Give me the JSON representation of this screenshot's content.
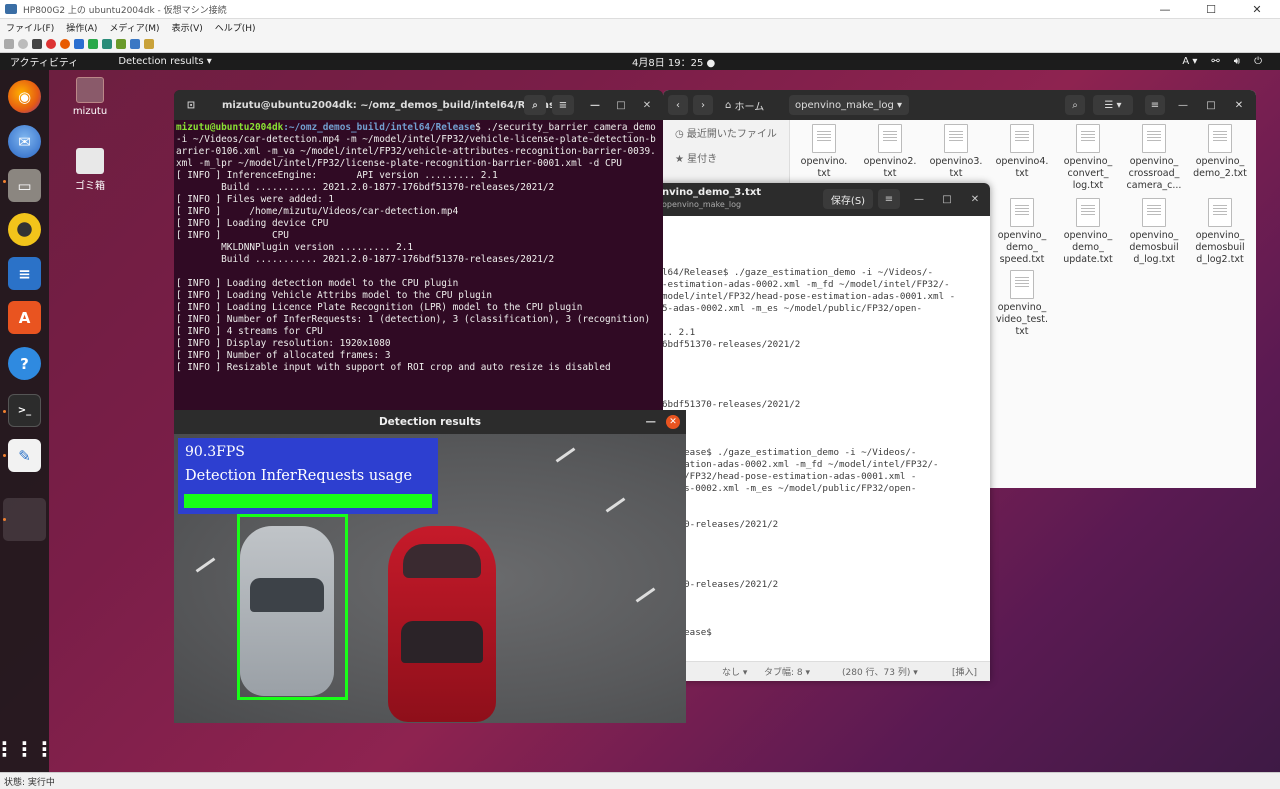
{
  "host": {
    "title": "HP800G2 上の ubuntu2004dk - 仮想マシン接続",
    "menu": [
      "ファイル(F)",
      "操作(A)",
      "メディア(M)",
      "表示(V)",
      "ヘルプ(H)"
    ],
    "status": "状態: 実行中"
  },
  "topbar": {
    "activities": "アクティビティ",
    "app_menu": "Detection results ▾",
    "clock": "4月8日 19：25 ●",
    "lang": "A ▾"
  },
  "desktop_icons": [
    {
      "label": "mizutu",
      "icon": "home-folder-icon"
    },
    {
      "label": "ゴミ箱",
      "icon": "trash-icon"
    }
  ],
  "dock": [
    "firefox-icon",
    "thunderbird-icon",
    "files-icon",
    "rhythmbox-icon",
    "writer-icon",
    "software-icon",
    "help-icon",
    "terminal-icon",
    "text-editor-icon",
    "show-apps-icon"
  ],
  "terminal": {
    "title": "mizutu@ubuntu2004dk: ~/omz_demos_build/intel64/Release",
    "prompt_user": "mizutu@ubuntu2004dk",
    "prompt_path": ":~/omz_demos_build/intel64/Release",
    "command": "$ ./security_barrier_camera_demo -i ~/Videos/car-detection.mp4 -m ~/model/intel/FP32/vehicle-license-plate-detection-barrier-0106.xml -m_va ~/model/intel/FP32/vehicle-attributes-recognition-barrier-0039.xml -m_lpr ~/model/intel/FP32/license-plate-recognition-barrier-0001.xml -d CPU",
    "output": "[ INFO ] InferenceEngine:       API version ......... 2.1\n        Build ........... 2021.2.0-1877-176bdf51370-releases/2021/2\n[ INFO ] Files were added: 1\n[ INFO ]     /home/mizutu/Videos/car-detection.mp4\n[ INFO ] Loading device CPU\n[ INFO ]         CPU\n        MKLDNNPlugin version ......... 2.1\n        Build ........... 2021.2.0-1877-176bdf51370-releases/2021/2\n\n[ INFO ] Loading detection model to the CPU plugin\n[ INFO ] Loading Vehicle Attribs model to the CPU plugin\n[ INFO ] Loading Licence Plate Recognition (LPR) model to the CPU plugin\n[ INFO ] Number of InferRequests: 1 (detection), 3 (classification), 3 (recognition)\n[ INFO ] 4 streams for CPU\n[ INFO ] Display resolution: 1920x1080\n[ INFO ] Number of allocated frames: 3\n[ INFO ] Resizable input with support of ROI crop and auto resize is disabled"
  },
  "files": {
    "location": "ホーム",
    "folder": "openvino_make_log",
    "sidebar": [
      "最近開いたファイル",
      "星付き"
    ],
    "items": [
      "openvino.\ntxt",
      "openvino2.\ntxt",
      "openvino3.\ntxt",
      "openvino4.\ntxt",
      "openvino_\nconvert_\nlog.txt",
      "openvino_\ncrossroad_\ncamera_c...",
      "openvino_\ndemo_2.txt",
      "openvino_\ndemo_\nspeed.txt",
      "openvino_\ndemo_\nupdate.txt",
      "openvino_\ndemosbuil\nd_log.txt",
      "openvino_\ndemosbuil\nd_log2.txt",
      "openvino_\nvideo_test.\ntxt"
    ]
  },
  "editor": {
    "title": "nvino_demo_3.txt",
    "subtitle": "openvino_make_log",
    "save": "保存(S)",
    "lines": "\n\n\n\nl64/Release$ ./gaze_estimation_demo -i ~/Videos/-\n-estimation-adas-0002.xml -m_fd ~/model/intel/FP32/-\nmodel/intel/FP32/head-pose-estimation-adas-0001.xml -\n5-adas-0002.xml -m_es ~/model/public/FP32/open-\n\n.. 2.1\n6bdf51370-releases/2021/2\n\n\n\n\n6bdf51370-releases/2021/2\n\n\n\n/Release$ ./gaze_estimation_demo -i ~/Videos/-\nstimation-adas-0002.xml -m_fd ~/model/intel/FP32/-\nntel/FP32/head-pose-estimation-adas-0001.xml -\n-adas-0002.xml -m_es ~/model/public/FP32/open-\n\n2.1\n51370-releases/2021/2\n\n\n\n\n51370-releases/2021/2\n\n\n\n/Release$",
    "dashes": "------------------------------------",
    "status_mode": "なし ▾",
    "status_tab": "タブ幅: 8 ▾",
    "status_pos": "(280 行、73 列) ▾",
    "status_ins": "[挿入]"
  },
  "detection": {
    "title": "Detection results",
    "fps": "90.3FPS",
    "label": "Detection InferRequests usage",
    "usage": 1.0
  }
}
